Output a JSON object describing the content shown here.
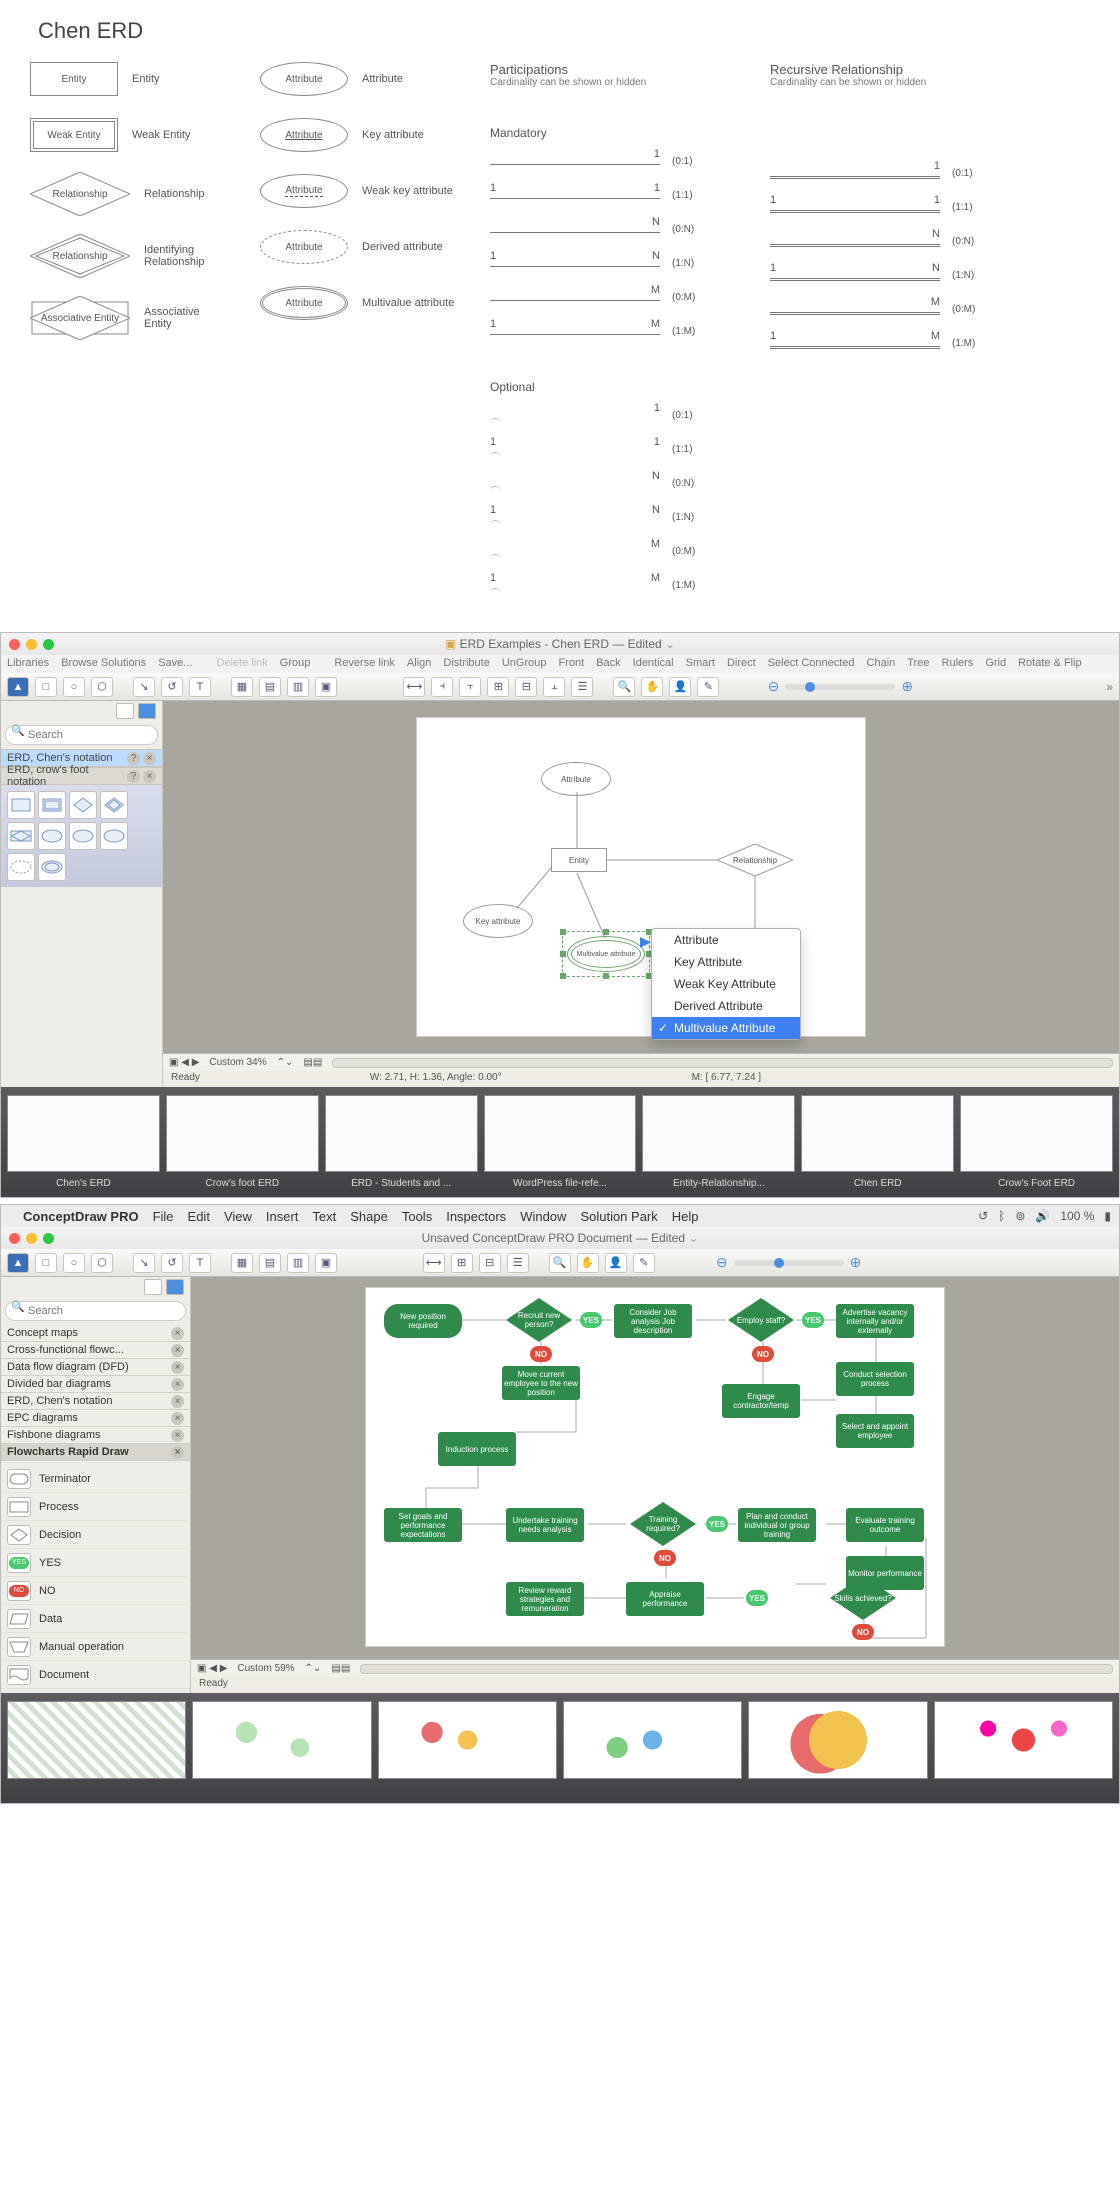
{
  "section1": {
    "title": "Chen ERD",
    "symbols_left": [
      {
        "shape": "rect",
        "text": "Entity",
        "label": "Entity"
      },
      {
        "shape": "rect2",
        "text": "Weak Entity",
        "label": "Weak Entity"
      },
      {
        "shape": "diamond",
        "text": "Relationship",
        "label": "Relationship"
      },
      {
        "shape": "diamond2",
        "text": "Relationship",
        "label": "Identifying Relationship"
      },
      {
        "shape": "diarect",
        "text": "Associative Entity",
        "label": "Associative Entity"
      }
    ],
    "symbols_right": [
      {
        "shape": "ellipse",
        "text": "Attribute",
        "label": "Attribute",
        "underline": false
      },
      {
        "shape": "ellipse",
        "text": "Attribute",
        "label": "Key attribute",
        "underline": true
      },
      {
        "shape": "ellipse",
        "text": "Attribute",
        "label": "Weak key attribute",
        "underline": false,
        "dash_ul": true
      },
      {
        "shape": "ellipse-dash",
        "text": "Attribute",
        "label": "Derived attribute"
      },
      {
        "shape": "ellipse2",
        "text": "Attribute",
        "label": "Multivalue attribute"
      }
    ],
    "participations": {
      "title": "Participations",
      "subtitle": "Cardinality can be shown or hidden",
      "mandatory_label": "Mandatory",
      "optional_label": "Optional",
      "lines": [
        {
          "l": "",
          "r": "1",
          "card": "(0:1)"
        },
        {
          "l": "1",
          "r": "1",
          "card": "(1:1)"
        },
        {
          "l": "",
          "r": "N",
          "card": "(0:N)"
        },
        {
          "l": "1",
          "r": "N",
          "card": "(1:N)"
        },
        {
          "l": "",
          "r": "M",
          "card": "(0:M)"
        },
        {
          "l": "1",
          "r": "M",
          "card": "(1:M)"
        }
      ]
    },
    "recursive": {
      "title": "Recursive Relationship",
      "subtitle": "Cardinality can be shown or hidden",
      "lines": [
        {
          "l": "",
          "r": "1",
          "card": "(0:1)"
        },
        {
          "l": "1",
          "r": "1",
          "card": "(1:1)"
        },
        {
          "l": "",
          "r": "N",
          "card": "(0:N)"
        },
        {
          "l": "1",
          "r": "N",
          "card": "(1:N)"
        },
        {
          "l": "",
          "r": "M",
          "card": "(0:M)"
        },
        {
          "l": "1",
          "r": "M",
          "card": "(1:M)"
        }
      ]
    }
  },
  "app1": {
    "title": "ERD Examples - Chen ERD — Edited",
    "menu": [
      "Libraries",
      "Browse Solutions",
      "Save...",
      "",
      "Delete link",
      "Group",
      "",
      "Reverse link",
      "Align",
      "Distribute",
      "UnGroup",
      "Front",
      "Back",
      "Identical",
      "Smart",
      "Direct",
      "Select Connected",
      "Chain",
      "Tree",
      "Rulers",
      "Grid",
      "Rotate & Flip"
    ],
    "search_placeholder": "Search",
    "libs": [
      {
        "name": "ERD, Chen's notation",
        "active": true
      },
      {
        "name": "ERD, crow's foot notation",
        "active": false
      }
    ],
    "canvas_nodes": {
      "attribute": "Attribute",
      "entity": "Entity",
      "relationship": "Relationship",
      "key_attr": "Key attribute",
      "multivalue": "Multivalue attribute"
    },
    "context_menu": [
      "Attribute",
      "Key Attribute",
      "Weak Key Attribute",
      "Derived Attribute",
      "Multivalue Attribute"
    ],
    "context_selected": "Multivalue Attribute",
    "ruler": {
      "custom": "Custom 34%"
    },
    "status": {
      "ready": "Ready",
      "dims": "W: 2.71,  H: 1.36,  Angle: 0.00°",
      "mouse": "M: [ 6.77, 7.24 ]"
    },
    "thumbs": [
      "Chen's ERD",
      "Crow's foot ERD",
      "ERD - Students and ...",
      "WordPress file-refe...",
      "Entity-Relationship...",
      "Chen ERD",
      "Crow's Foot ERD"
    ]
  },
  "app2": {
    "menubar": [
      "ConceptDraw PRO",
      "File",
      "Edit",
      "View",
      "Insert",
      "Text",
      "Shape",
      "Tools",
      "Inspectors",
      "Window",
      "Solution Park",
      "Help"
    ],
    "status_pct": "100 %",
    "title": "Unsaved ConceptDraw PRO Document — Edited",
    "search_placeholder": "Search",
    "libs": [
      "Concept maps",
      "Cross-functional flowc...",
      "Data flow diagram (DFD)",
      "Divided bar diagrams",
      "ERD, Chen's notation",
      "EPC diagrams",
      "Fishbone diagrams",
      "Flowcharts Rapid Draw"
    ],
    "lib_selected": "Flowcharts Rapid Draw",
    "shapes": [
      "Terminator",
      "Process",
      "Decision",
      "YES",
      "NO",
      "Data",
      "Manual operation",
      "Document"
    ],
    "flow": {
      "new_pos": "New position required",
      "recruit": "Recruit new person?",
      "consider": "Consider Job analysis Job description",
      "employ": "Employ staff?",
      "advertise": "Advertise vacancy internally and/or externally",
      "conduct_sel": "Conduct selection process",
      "move": "Move current employee to the new position",
      "engage": "Engage contractor/temp",
      "select_appoint": "Select and appoint employee",
      "induction": "Induction process",
      "set_goals": "Set goals and performance expectations",
      "undertake": "Undertake training needs analysis",
      "train_req": "Training required?",
      "plan_train": "Plan and conduct individual or group training",
      "eval": "Evaluate training outcome",
      "monitor": "Monitor performance",
      "review": "Review reward strategies and remuneration",
      "appraise": "Appraise performance",
      "skills": "Skills achieved?",
      "yes": "YES",
      "no": "NO"
    },
    "ruler": {
      "custom": "Custom 59%"
    },
    "status": {
      "ready": "Ready"
    }
  }
}
